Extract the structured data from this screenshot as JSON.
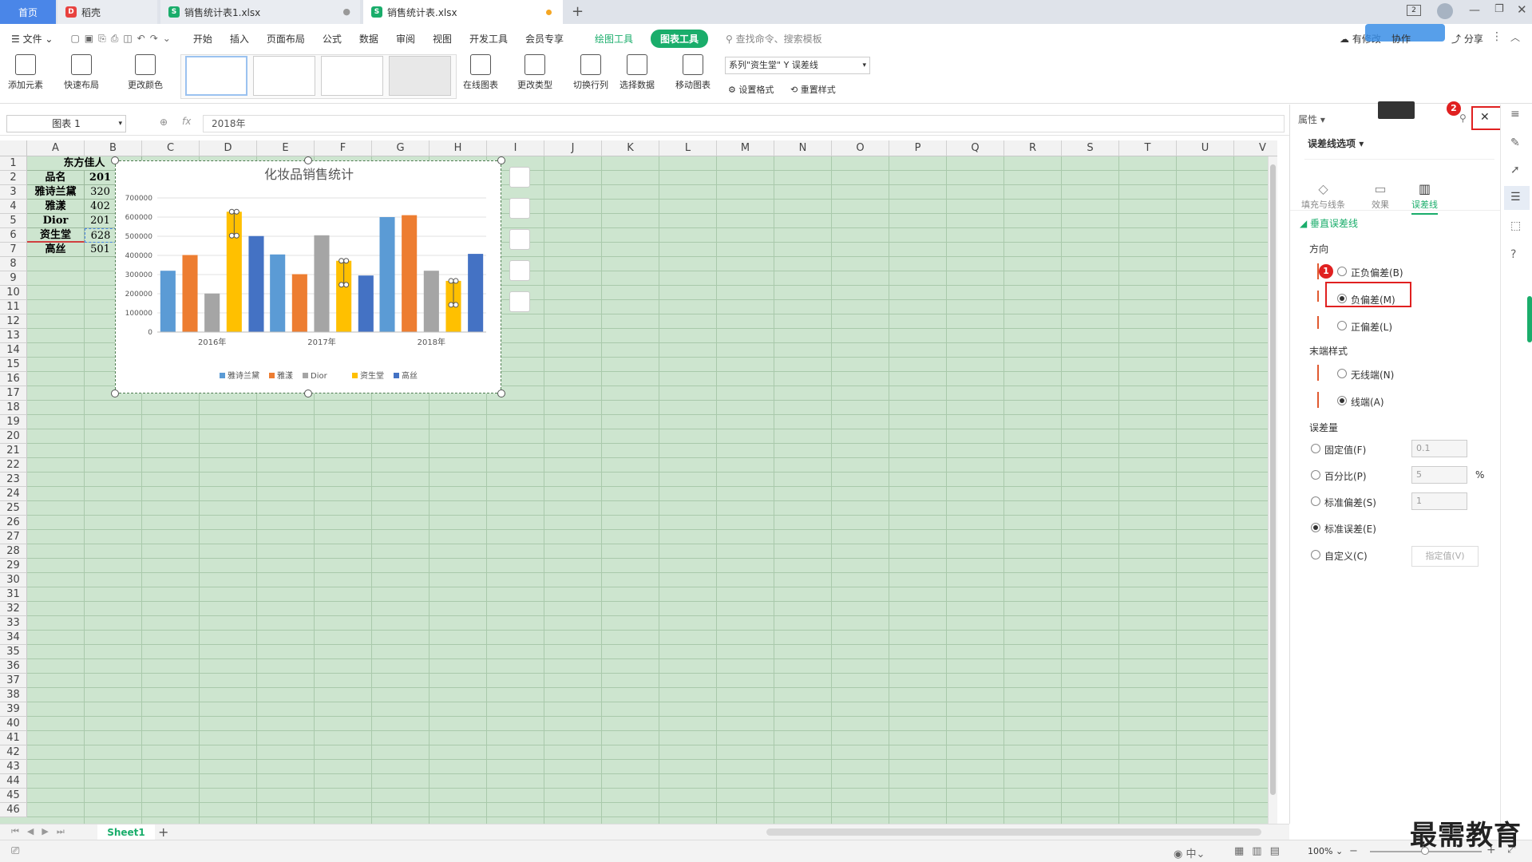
{
  "tabs": {
    "home": "首页",
    "daoke": "稻壳",
    "file1": "销售统计表1.xlsx",
    "file2": "销售统计表.xlsx",
    "tab_count": "2"
  },
  "menu": {
    "file": "文件",
    "items": [
      "开始",
      "插入",
      "页面布局",
      "公式",
      "数据",
      "审阅",
      "视图",
      "开发工具",
      "会员专享"
    ],
    "drawing_tools": "绘图工具",
    "chart_tools": "图表工具",
    "search_placeholder": "查找命令、搜索模板",
    "share": "分享",
    "unsynced": "有修改",
    "collab": "协作"
  },
  "ribbon": {
    "add_element": "添加元素",
    "quick_layout": "快速布局",
    "change_color": "更改颜色",
    "online_chart": "在线图表",
    "change_type": "更改类型",
    "switch_rowcol": "切换行列",
    "select_data": "选择数据",
    "move_chart": "移动图表",
    "series_select": "系列\"资生堂\" Y 误差线",
    "set_format": "设置格式",
    "reset_style": "重置样式"
  },
  "formula": {
    "name_box": "图表 1",
    "fx": "fx",
    "value": "2018年"
  },
  "columns": [
    "A",
    "B",
    "C",
    "D",
    "E",
    "F",
    "G",
    "H",
    "I",
    "J",
    "K",
    "L",
    "M",
    "N",
    "O",
    "P",
    "Q",
    "R",
    "S",
    "T",
    "U",
    "V"
  ],
  "sheet_cells": {
    "title": "东方佳人",
    "header_name": "品名",
    "header_year": "201",
    "rows": [
      {
        "name": "雅诗兰黛",
        "value": "320"
      },
      {
        "name": "雅漾",
        "value": "402"
      },
      {
        "name": "Dior",
        "value": "201"
      },
      {
        "name": "资生堂",
        "value": "628"
      },
      {
        "name": "高丝",
        "value": "501"
      }
    ]
  },
  "chart_data": {
    "type": "bar",
    "title": "化妆品销售统计",
    "categories": [
      "2016年",
      "2017年",
      "2018年"
    ],
    "series": [
      {
        "name": "雅诗兰黛",
        "color": "#5b9bd5",
        "values": [
          320000,
          405000,
          600000
        ]
      },
      {
        "name": "雅漾",
        "color": "#ed7d31",
        "values": [
          402000,
          302000,
          610000
        ]
      },
      {
        "name": "Dior",
        "color": "#a5a5a5",
        "values": [
          201000,
          505000,
          320000
        ]
      },
      {
        "name": "资生堂",
        "color": "#ffc000",
        "values": [
          628000,
          372000,
          267000
        ]
      },
      {
        "name": "高丝",
        "color": "#4472c4",
        "values": [
          501000,
          295000,
          408000
        ]
      }
    ],
    "ylim": [
      0,
      700000
    ],
    "yticks": [
      "0",
      "100000",
      "200000",
      "300000",
      "400000",
      "500000",
      "600000",
      "700000"
    ],
    "legend": "bottom",
    "grid": true
  },
  "panel": {
    "properties": "属性",
    "options_dropdown": "误差线选项",
    "tab_fill": "填充与线条",
    "tab_effect": "效果",
    "tab_errorbar": "误差线",
    "section": "垂直误差线",
    "direction": "方向",
    "dir_both": "正负偏差(B)",
    "dir_minus": "负偏差(M)",
    "dir_plus": "正偏差(L)",
    "end_style": "末端样式",
    "no_cap": "无线端(N)",
    "cap": "线端(A)",
    "amount": "误差量",
    "fixed": "固定值(F)",
    "fixed_value": "0.1",
    "percent": "百分比(P)",
    "percent_value": "5",
    "percent_unit": "%",
    "stddev": "标准偏差(S)",
    "stddev_value": "1",
    "stderr": "标准误差(E)",
    "custom": "自定义(C)",
    "specify": "指定值(V)",
    "badge1": "1",
    "badge2": "2"
  },
  "sheetbar": {
    "sheet1": "Sheet1"
  },
  "status": {
    "zoom": "100%",
    "watermark": "最需教育"
  }
}
